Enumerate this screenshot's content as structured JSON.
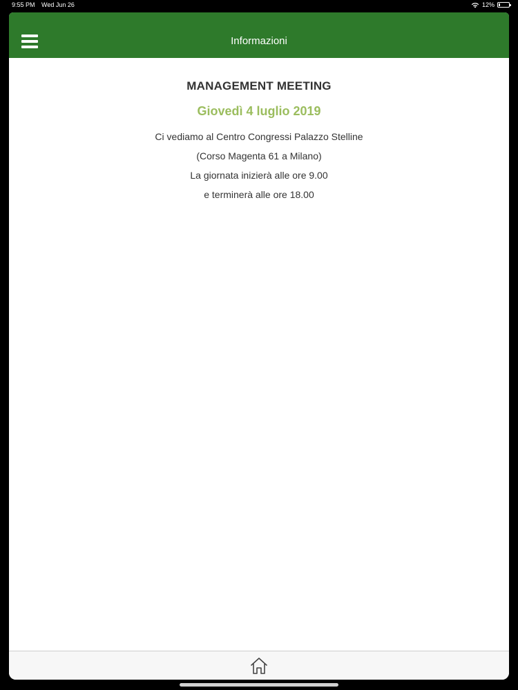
{
  "status_bar": {
    "time": "9:55 PM",
    "date": "Wed Jun 26",
    "battery": "12%",
    "battery_level": 0.12,
    "icons": [
      "wifi-icon",
      "battery-icon"
    ]
  },
  "nav": {
    "title": "Informazioni",
    "menu_icon": "hamburger-menu-icon",
    "color": "#2e7a2b"
  },
  "event": {
    "title": "MANAGEMENT MEETING",
    "date": "Giovedì 4 luglio 2019",
    "date_color": "#9bbd5e",
    "lines": [
      "Ci vediamo al Centro Congressi Palazzo Stelline",
      "(Corso Magenta 61 a Milano)",
      "La giornata inizierà alle ore  9.00",
      "e terminerà alle ore 18.00"
    ]
  },
  "tab_bar": {
    "home_icon": "home-icon"
  }
}
